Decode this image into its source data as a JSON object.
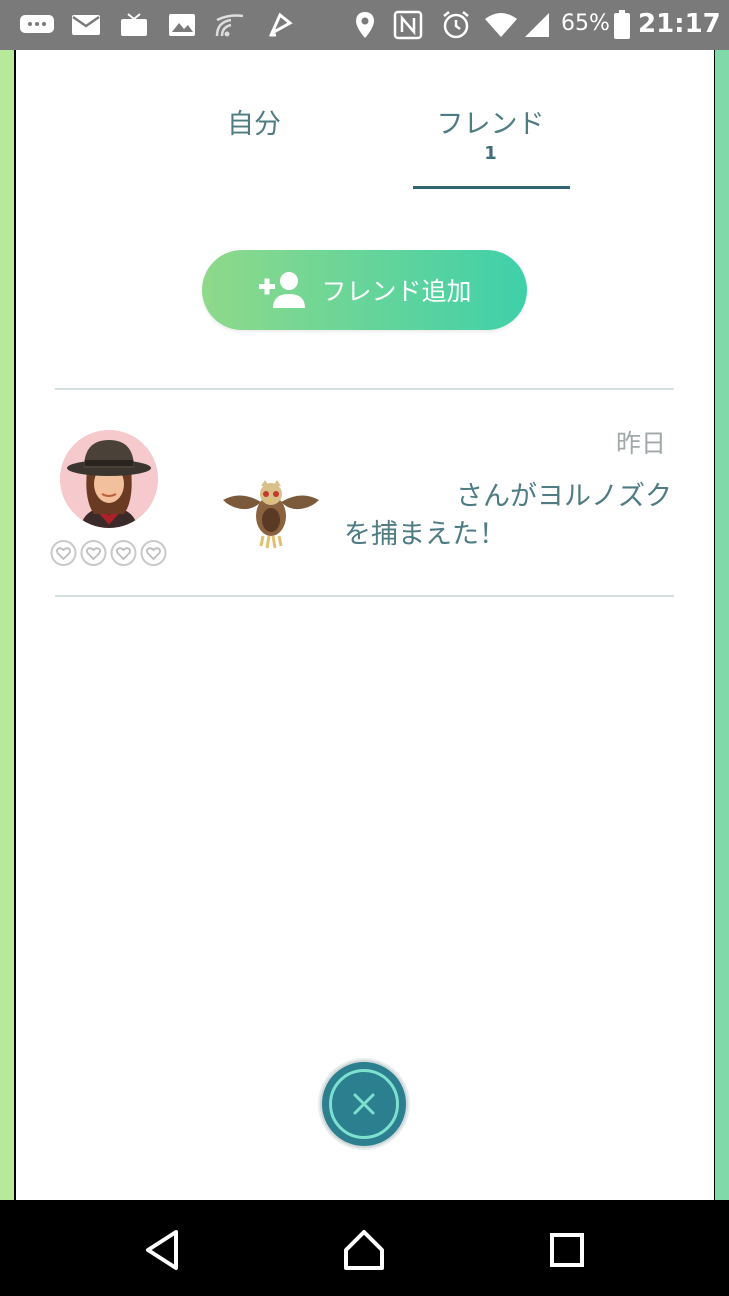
{
  "status_bar": {
    "battery_percent": "65%",
    "time": "21:17",
    "left_icons": [
      "chat-icon",
      "mail-icon",
      "tv-icon",
      "image-icon",
      "cast-icon",
      "ticket-icon"
    ],
    "right_icons": [
      "location-icon",
      "nfc-icon",
      "alarm-icon",
      "wifi-icon",
      "signal-icon",
      "battery-icon"
    ]
  },
  "tabs": [
    {
      "label": "自分"
    },
    {
      "label": "フレンド",
      "count": "1"
    }
  ],
  "add_friend_button": {
    "label": "フレンド追加",
    "icon": "add-person-icon"
  },
  "friends": [
    {
      "time": "昨日",
      "message": "さんがヨルノズクを捕まえた！",
      "hearts": 4,
      "pokemon_icon": "noctowl-icon"
    }
  ],
  "close_button": {
    "icon": "close-icon"
  },
  "nav": {
    "icons": [
      "back-icon",
      "home-icon",
      "recents-icon"
    ]
  },
  "colors": {
    "accent_teal": "#2b7f8f",
    "text_teal": "#4f7c83",
    "button_gradient_start": "#8fd98a",
    "button_gradient_end": "#3fd0a9"
  }
}
